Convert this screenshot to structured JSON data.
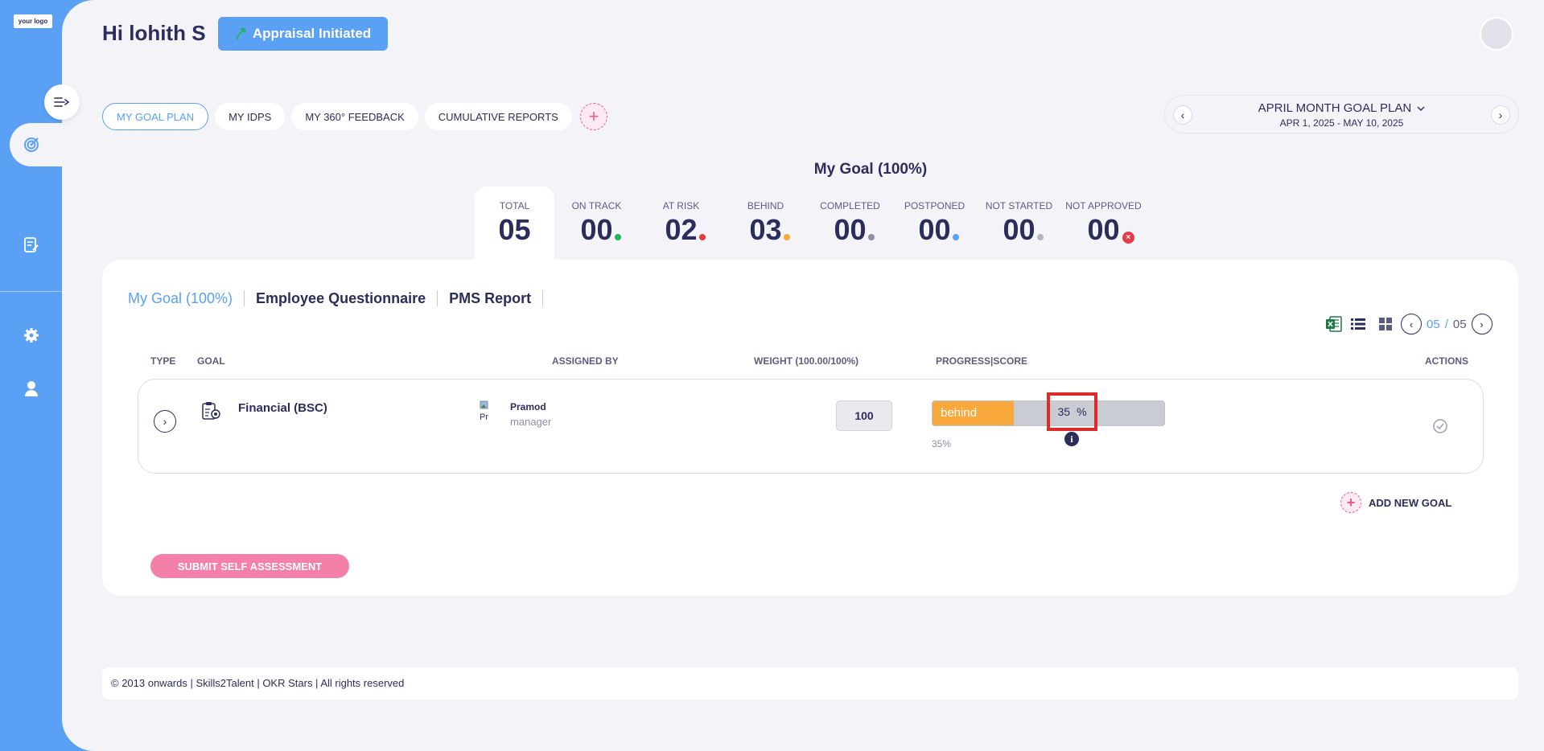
{
  "sidebar": {
    "logo_text": "your logo"
  },
  "header": {
    "greeting": "Hi lohith S",
    "status_label": "Appraisal Initiated"
  },
  "tabs": [
    {
      "label": "MY GOAL PLAN",
      "active": true
    },
    {
      "label": "MY IDPS"
    },
    {
      "label": "MY 360° FEEDBACK"
    },
    {
      "label": "CUMULATIVE REPORTS"
    }
  ],
  "plan": {
    "title": "APRIL MONTH GOAL PLAN",
    "dates": "APR 1, 2025 - MAY 10, 2025"
  },
  "goal_heading": "My Goal (100%)",
  "stats": [
    {
      "label": "TOTAL",
      "value": "05"
    },
    {
      "label": "ON TRACK",
      "value": "00",
      "color": "#22b45a"
    },
    {
      "label": "AT RISK",
      "value": "02",
      "color": "#e53b3b"
    },
    {
      "label": "BEHIND",
      "value": "03",
      "color": "#f9a93c"
    },
    {
      "label": "COMPLETED",
      "value": "00",
      "color": "#8c8ea6"
    },
    {
      "label": "POSTPONED",
      "value": "00",
      "color": "#5aa0f5"
    },
    {
      "label": "NOT STARTED",
      "value": "00",
      "color": "#b5b5c2"
    },
    {
      "label": "NOT APPROVED",
      "value": "00",
      "color": "#e53b4a"
    }
  ],
  "subtabs": [
    "My Goal (100%)",
    "Employee Questionnaire",
    "PMS Report"
  ],
  "pager": {
    "current": "05",
    "separator": "/",
    "total": "05"
  },
  "columns": {
    "type": "TYPE",
    "goal": "GOAL",
    "assigned_by": "ASSIGNED BY",
    "weight": "WEIGHT (100.00/100%)",
    "progress": "PROGRESS|SCORE",
    "actions": "ACTIONS"
  },
  "row": {
    "goal": "Financial (BSC)",
    "avatar_alt": "Pr",
    "assigned_name": "Pramod",
    "assigned_role": "manager",
    "weight": "100",
    "progress_label": "behind",
    "progress_value": 0.35,
    "progress_pct": "35%",
    "score": "35",
    "score_unit": "%"
  },
  "add_goal": "ADD NEW GOAL",
  "submit": "SUBMIT SELF ASSESSMENT",
  "footer": "© 2013 onwards | Skills2Talent | OKR Stars | All rights reserved"
}
